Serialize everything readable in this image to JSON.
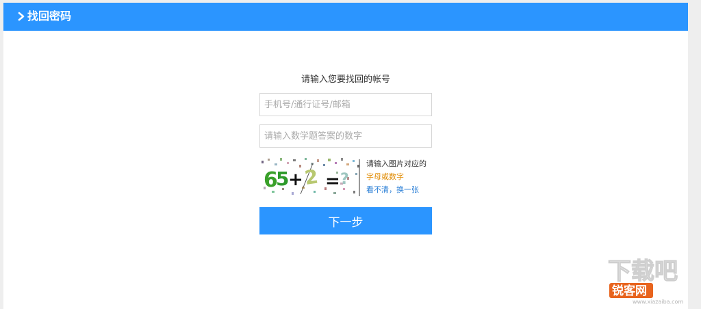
{
  "header": {
    "title": "找回密码",
    "chevron_icon": "chevron-right-icon",
    "color": "#2b95ff"
  },
  "form": {
    "prompt": "请输入您要找回的帐号",
    "account_placeholder": "手机号/通行证号/邮箱",
    "answer_placeholder": "请输入数学题答案的数字",
    "captcha": {
      "expression": "65+2=?",
      "hint_line1": "请输入图片对应的",
      "hint_line2": "字母或数字",
      "refresh_link": "看不清，换一张"
    },
    "next_button": "下一步"
  },
  "watermark": {
    "text_top": "下载吧",
    "text_main": "锐客网",
    "url": "www.xiazaiba.com"
  }
}
